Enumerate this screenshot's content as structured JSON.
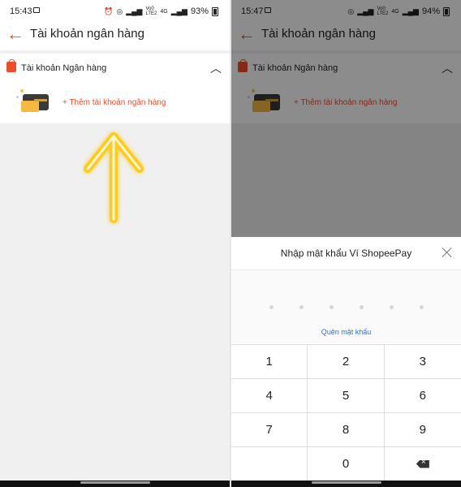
{
  "left": {
    "status": {
      "time": "15:43",
      "battery": "93%",
      "net_top": "Vo0",
      "net_bottom": "LTE2",
      "net_g": "4G"
    },
    "title": "Tài khoản ngân hàng",
    "section_title": "Tài khoản Ngân hàng",
    "add_label": "+ Thêm tài khoản ngân hàng"
  },
  "right": {
    "status": {
      "time": "15:47",
      "battery": "94%",
      "net_top": "Vo0",
      "net_bottom": "LTE2",
      "net_g": "4G"
    },
    "title": "Tài khoản ngân hàng",
    "section_title": "Tài khoản Ngân hàng",
    "add_label": "+ Thêm tài khoản ngân hàng",
    "sheet": {
      "title": "Nhập mật khẩu Ví ShopeePay",
      "forgot": "Quên mật khẩu",
      "keys": [
        "1",
        "2",
        "3",
        "4",
        "5",
        "6",
        "7",
        "8",
        "9",
        "",
        "0",
        ""
      ]
    }
  },
  "colors": {
    "accent": "#ee4d2d",
    "link": "#2673dd",
    "gesture": "#ffc400"
  },
  "icons": {
    "back": "back-arrow-icon",
    "shop": "shopee-bag-icon",
    "chevron": "chevron-up-icon",
    "close": "close-icon",
    "backspace": "backspace-icon"
  }
}
